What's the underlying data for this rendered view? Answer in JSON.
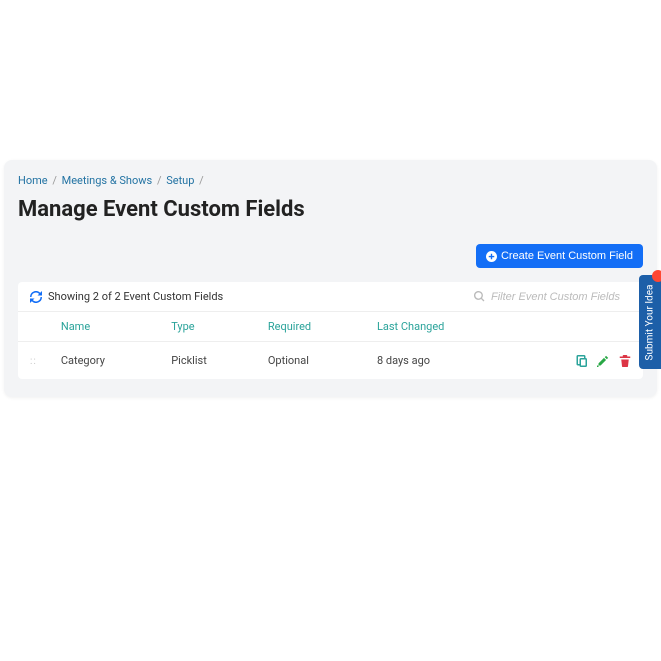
{
  "breadcrumb": {
    "home": "Home",
    "meetings": "Meetings & Shows",
    "setup": "Setup"
  },
  "page": {
    "title": "Manage Event Custom Fields"
  },
  "toolbar": {
    "create_label": "Create Event Custom Field"
  },
  "panel": {
    "status": "Showing 2 of 2 Event Custom Fields",
    "filter_placeholder": "Filter Event Custom Fields"
  },
  "table": {
    "headers": {
      "name": "Name",
      "type": "Type",
      "required": "Required",
      "last_changed": "Last Changed"
    },
    "rows": [
      {
        "name": "Category",
        "type": "Picklist",
        "required": "Optional",
        "last_changed": "8 days ago"
      }
    ]
  },
  "feedback": {
    "label": "Submit Your Idea"
  }
}
